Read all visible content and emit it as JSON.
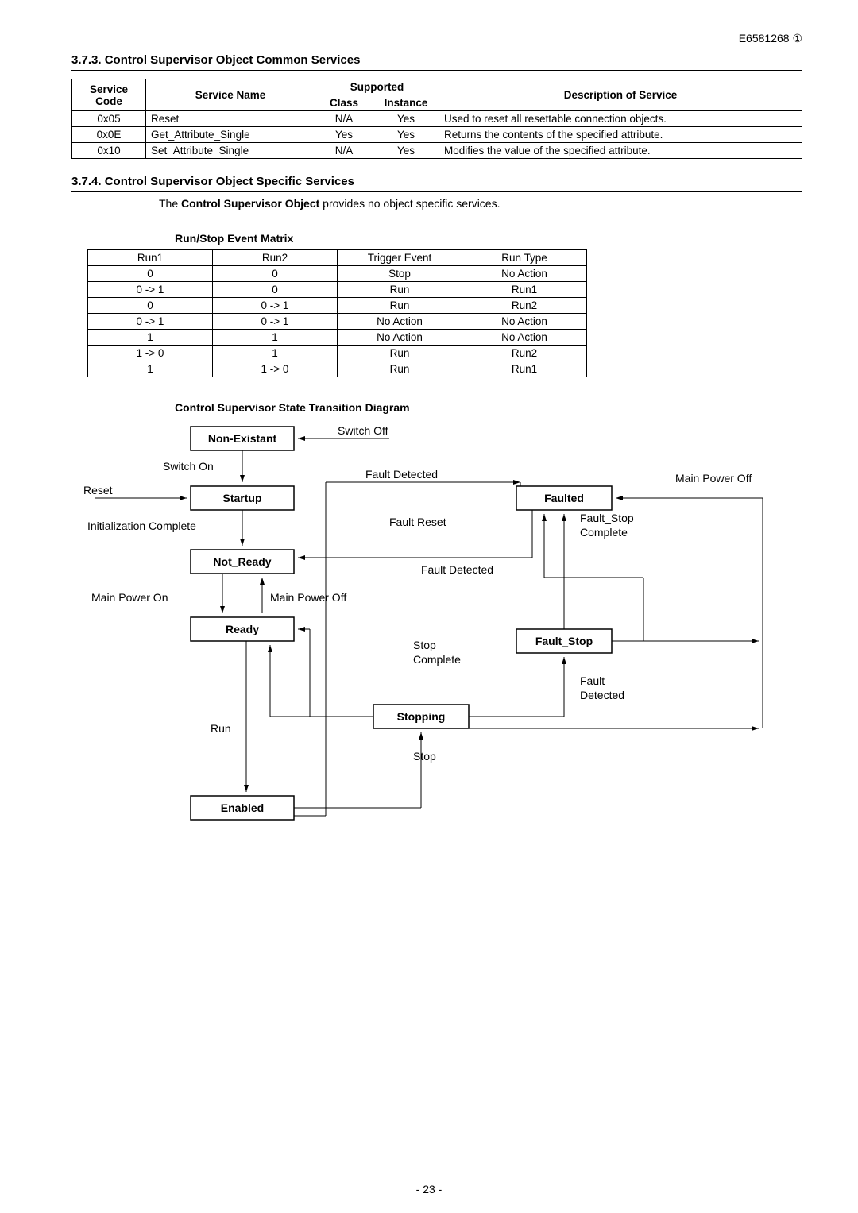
{
  "doc_id": "E6581268 ①",
  "section_373": "3.7.3.   Control Supervisor Object Common Services",
  "services_header": {
    "code": "Service Code",
    "name": "Service Name",
    "supported": "Supported",
    "class": "Class",
    "instance": "Instance",
    "desc": "Description of Service"
  },
  "services": [
    {
      "code": "0x05",
      "name": "Reset",
      "class": "N/A",
      "instance": "Yes",
      "desc": "Used to reset all resettable connection objects."
    },
    {
      "code": "0x0E",
      "name": "Get_Attribute_Single",
      "class": "Yes",
      "instance": "Yes",
      "desc": "Returns the contents of the specified attribute."
    },
    {
      "code": "0x10",
      "name": "Set_Attribute_Single",
      "class": "N/A",
      "instance": "Yes",
      "desc": "Modifies the value of the specified attribute."
    }
  ],
  "section_374": "3.7.4.   Control Supervisor Object Specific Services",
  "specific_body_prefix": "The ",
  "specific_body_bold": "Control Supervisor Object",
  "specific_body_suffix": " provides no object specific services.",
  "matrix_heading": "Run/Stop Event Matrix",
  "matrix_header": {
    "run1": "Run1",
    "run2": "Run2",
    "trigger": "Trigger Event",
    "type": "Run Type"
  },
  "matrix_rows": [
    {
      "r1": "0",
      "r2": "0",
      "t": "Stop",
      "ty": "No Action"
    },
    {
      "r1": "0 -> 1",
      "r2": "0",
      "t": "Run",
      "ty": "Run1"
    },
    {
      "r1": "0",
      "r2": "0 -> 1",
      "t": "Run",
      "ty": "Run2"
    },
    {
      "r1": "0 -> 1",
      "r2": "0 -> 1",
      "t": "No Action",
      "ty": "No Action"
    },
    {
      "r1": "1",
      "r2": "1",
      "t": "No Action",
      "ty": "No Action"
    },
    {
      "r1": "1 -> 0",
      "r2": "1",
      "t": "Run",
      "ty": "Run2"
    },
    {
      "r1": "1",
      "r2": "1 -> 0",
      "t": "Run",
      "ty": "Run1"
    }
  ],
  "diagram_heading": "Control Supervisor State Transition Diagram",
  "diagram": {
    "non_existant": "Non-Existant",
    "switch_off": "Switch Off",
    "switch_on": "Switch On",
    "reset": "Reset",
    "startup": "Startup",
    "fault_detected": "Fault Detected",
    "faulted": "Faulted",
    "main_power_off": "Main Power Off",
    "init_complete": "Initialization Complete",
    "fault_reset": "Fault Reset",
    "not_ready": "Not_Ready",
    "main_power_on": "Main Power On",
    "ready": "Ready",
    "stop_complete": "Stop Complete",
    "fault_stop": "Fault_Stop",
    "fault_stop_complete_l1": "Fault_Stop",
    "fault_stop_complete_l2": "Complete",
    "fault": "Fault",
    "detected": "Detected",
    "run": "Run",
    "stopping": "Stopping",
    "stop": "Stop",
    "enabled": "Enabled"
  },
  "page_number": "- 23 -"
}
